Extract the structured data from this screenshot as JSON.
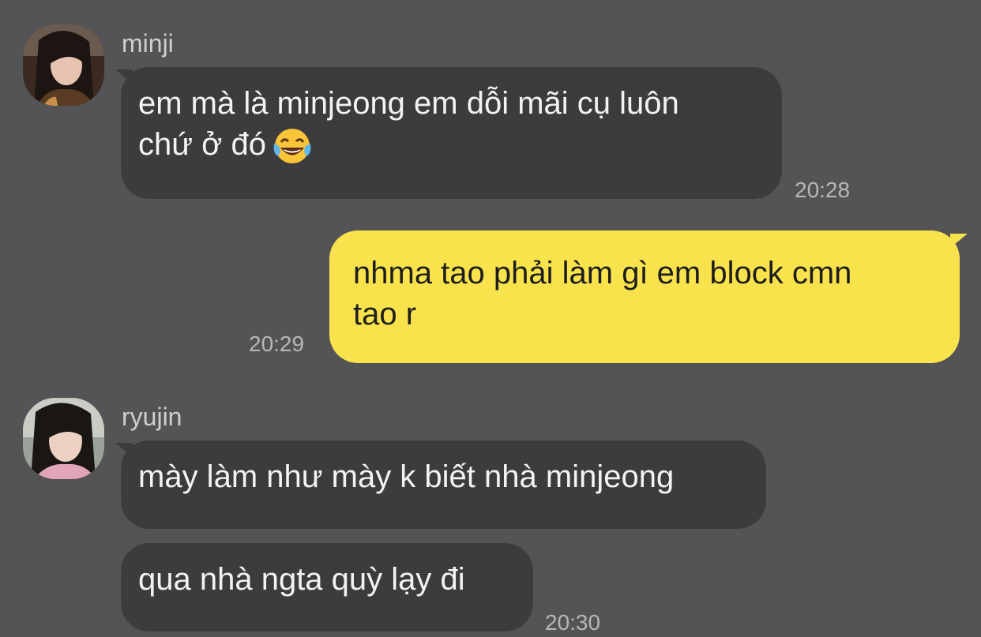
{
  "messages": [
    {
      "sender": "minji",
      "avatar": "minji-avatar",
      "text_line1": "em mà là minjeong em dỗi mãi cụ luôn",
      "text_line2": "chứ ở đó",
      "emoji": "face-with-tears-of-joy",
      "time": "20:28"
    },
    {
      "sender": "me",
      "text_line1": "nhma tao phải làm gì em block cmn",
      "text_line2": "tao r",
      "time": "20:29"
    },
    {
      "sender": "ryujin",
      "avatar": "ryujin-avatar",
      "text": "mày làm như mày k biết nhà minjeong"
    },
    {
      "sender": "ryujin",
      "text": "qua nhà ngta quỳ lạy đi",
      "time": "20:30"
    }
  ],
  "colors": {
    "background": "#545355",
    "incoming_bubble": "#3c3b3d",
    "outgoing_bubble": "#f8e34c",
    "incoming_text": "#f3f3f3",
    "outgoing_text": "#1d1d1d",
    "timestamp": "#b7b6b8",
    "sender_name": "#cfcfd1"
  }
}
